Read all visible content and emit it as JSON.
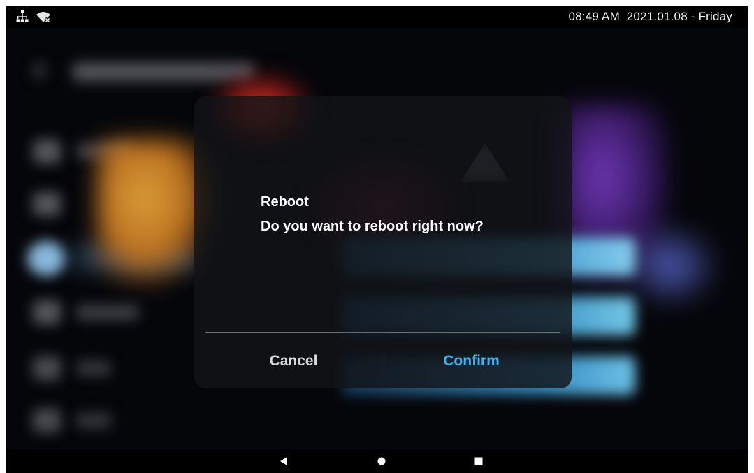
{
  "status_bar": {
    "time_date": "08:49 AM  2021.01.08 - Friday",
    "icons": [
      "network-icon",
      "wifi-off-icon"
    ]
  },
  "dialog": {
    "title": "Reboot",
    "message": "Do you want to reboot right now?",
    "cancel_label": "Cancel",
    "confirm_label": "Confirm",
    "confirm_color": "#41b4f0"
  },
  "nav_bar": {
    "icons": [
      "back-icon",
      "home-icon",
      "recents-icon"
    ]
  }
}
